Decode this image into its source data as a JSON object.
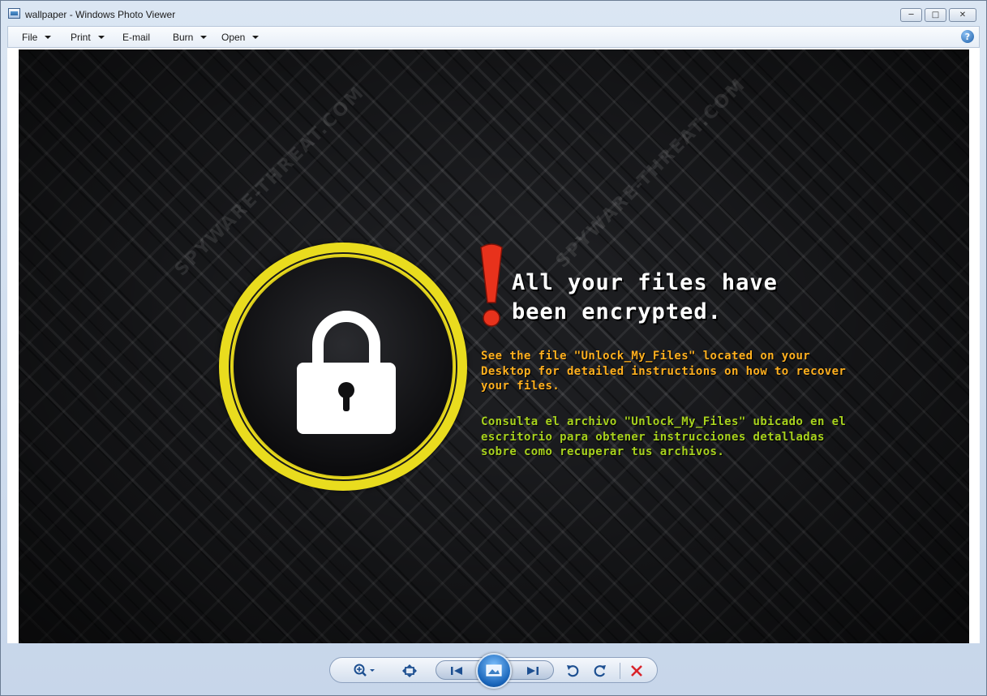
{
  "window": {
    "title": "wallpaper - Windows Photo Viewer",
    "minimize_glyph": "─",
    "maximize_glyph": "□",
    "close_glyph": "✕"
  },
  "menu": {
    "file": "File",
    "print": "Print",
    "email": "E-mail",
    "burn": "Burn",
    "open": "Open",
    "help_glyph": "?"
  },
  "image": {
    "headline_line1": "All your files have",
    "headline_line2": "been encrypted.",
    "english_message": "See the file \"Unlock_My_Files\" located on your\nDesktop for detailed instructions on how to recover\nyour files.",
    "spanish_message": "Consulta el archivo \"Unlock_My_Files\" ubicado en el\nescritorio para obtener instrucciones detalladas\nsobre como recuperar tus archivos.",
    "watermark_text": "SPYWARE-THREAT.COM",
    "colors": {
      "ring": "#e9dc1e",
      "exclamation": "#e8321c",
      "english_text": "#ffb01f",
      "spanish_text": "#a8d21e",
      "headline": "#ffffff"
    }
  },
  "controls": {
    "zoom_icon": "magnifier-icon",
    "fit_icon": "actual-size-icon",
    "prev_icon": "previous-icon",
    "slideshow_icon": "slideshow-icon",
    "next_icon": "next-icon",
    "rotate_ccw_icon": "rotate-counterclockwise-icon",
    "rotate_cw_icon": "rotate-clockwise-icon",
    "delete_icon": "delete-icon",
    "delete_color": "#d9232a"
  }
}
